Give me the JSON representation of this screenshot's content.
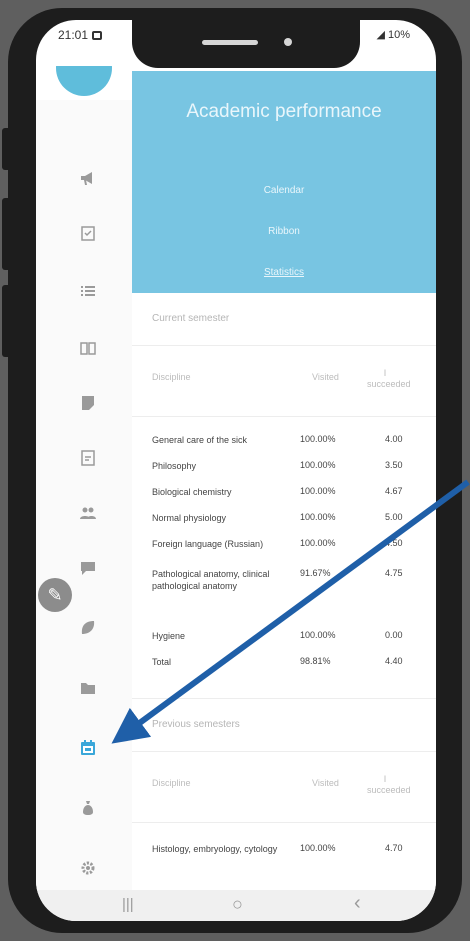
{
  "status_bar": {
    "time": "21:01",
    "signal": "◢ 10%"
  },
  "sidebar": {
    "icons": [
      "megaphone-icon",
      "clipboard-check-icon",
      "list-icon",
      "book-icon",
      "note-icon",
      "task-icon",
      "users-icon",
      "chat-icon",
      "leaf-icon",
      "folder-icon",
      "calendar-icon",
      "moneybag-icon",
      "gear-icon"
    ],
    "active_icon": "calendar-icon",
    "active_color": "#3aa7d9"
  },
  "header": {
    "title": "Academic performance",
    "links": [
      "Calendar",
      "Ribbon",
      "Statistics"
    ],
    "active_link": "Statistics",
    "color": "#78c5e2"
  },
  "current": {
    "title": "Current semester",
    "columns": {
      "discipline": "Discipline",
      "visited": "Visited",
      "succeeded": "I succeeded"
    },
    "rows": [
      {
        "name": "General care of the sick",
        "visited": "100.00%",
        "grade": "4.00"
      },
      {
        "name": "Philosophy",
        "visited": "100.00%",
        "grade": "3.50"
      },
      {
        "name": "Biological chemistry",
        "visited": "100.00%",
        "grade": "4.67"
      },
      {
        "name": "Normal physiology",
        "visited": "100.00%",
        "grade": "5.00"
      },
      {
        "name": "Foreign language (Russian)",
        "visited": "100.00%",
        "grade": "4.50"
      },
      {
        "name": "Pathological anatomy, clinical pathological anatomy",
        "visited": "91.67%",
        "grade": "4.75"
      },
      {
        "name": "Hygiene",
        "visited": "100.00%",
        "grade": "0.00"
      },
      {
        "name": "Total",
        "visited": "98.81%",
        "grade": "4.40"
      }
    ]
  },
  "previous": {
    "title": "Previous semesters",
    "columns": {
      "discipline": "Discipline",
      "visited": "Visited",
      "succeeded": "I succeeded"
    },
    "rows": [
      {
        "name": "Histology, embryology, cytology",
        "visited": "100.00%",
        "grade": "4.70"
      }
    ]
  },
  "annotation": {
    "arrow_color": "#1f5fa8"
  },
  "nav_bar": {
    "recent": "|||",
    "home": "○",
    "back": "‹"
  }
}
